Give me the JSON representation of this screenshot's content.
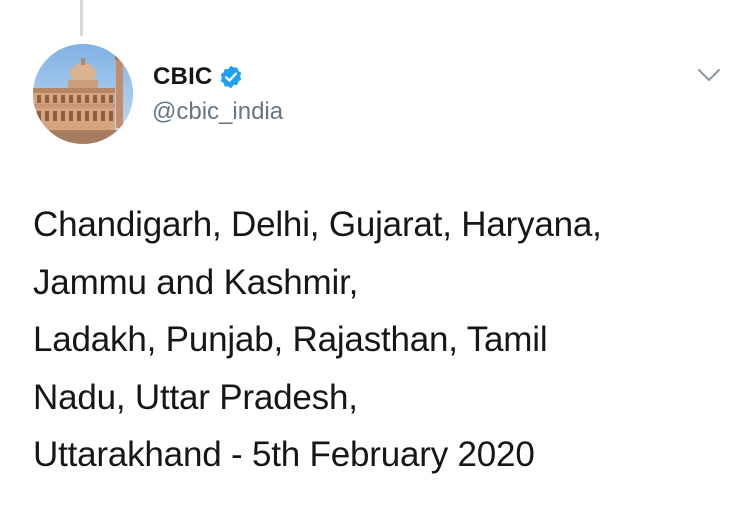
{
  "tweet": {
    "author": {
      "display_name": "CBIC",
      "handle": "@cbic_india",
      "verified": true,
      "avatar_icon": "government-building-avatar",
      "verified_icon": "verified-badge-icon"
    },
    "menu_icon": "chevron-down-icon",
    "text_lines": [
      "Chandigarh, Delhi, Gujarat, Haryana,",
      "Jammu and Kashmir,",
      "Ladakh, Punjab, Rajasthan, Tamil",
      "Nadu, Uttar Pradesh,",
      "Uttarakhand - 5th February 2020"
    ]
  },
  "colors": {
    "text": "#14171a",
    "secondary_text": "#657786",
    "verified_blue": "#1da1f2",
    "thread_line": "#cfd9de",
    "chevron": "#8899a6"
  }
}
